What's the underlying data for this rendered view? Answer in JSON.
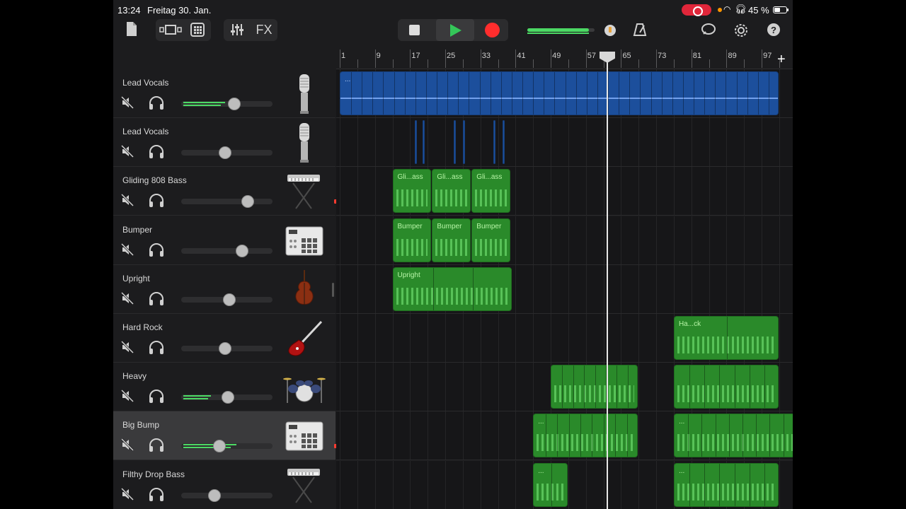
{
  "status": {
    "time": "13:24",
    "date": "Freitag 30. Jan.",
    "battery": "45 %"
  },
  "toolbar": {
    "fx_label": "FX"
  },
  "ruler": {
    "labels": [
      "1",
      "9",
      "17",
      "25",
      "33",
      "41",
      "49",
      "57",
      "65",
      "73",
      "81",
      "89",
      "97"
    ]
  },
  "tracks": [
    {
      "name": "Lead Vocals",
      "instrument": "microphone-icon",
      "volume": 0.6,
      "level": 0.55,
      "clipping": false,
      "selected": false
    },
    {
      "name": "Lead Vocals",
      "instrument": "microphone-icon",
      "volume": 0.48,
      "level": 0.0,
      "clipping": false,
      "selected": false
    },
    {
      "name": "Gliding 808 Bass",
      "instrument": "keyboard-icon",
      "volume": 0.78,
      "level": 0.0,
      "clipping": true,
      "selected": false
    },
    {
      "name": "Bumper",
      "instrument": "drum-machine-icon",
      "volume": 0.7,
      "level": 0.0,
      "clipping": false,
      "selected": false
    },
    {
      "name": "Upright",
      "instrument": "double-bass-icon",
      "volume": 0.53,
      "level": 0.0,
      "clipping": false,
      "selected": false
    },
    {
      "name": "Hard Rock",
      "instrument": "electric-guitar-icon",
      "volume": 0.48,
      "level": 0.0,
      "clipping": false,
      "selected": false
    },
    {
      "name": "Heavy",
      "instrument": "drum-kit-icon",
      "volume": 0.51,
      "level": 0.36,
      "clipping": false,
      "selected": false
    },
    {
      "name": "Big Bump",
      "instrument": "drum-machine-icon",
      "volume": 0.4,
      "level": 0.7,
      "clipping": true,
      "selected": true
    },
    {
      "name": "Filthy Drop Bass",
      "instrument": "keyboard-icon",
      "volume": 0.34,
      "level": 0.0,
      "clipping": false,
      "selected": false
    }
  ],
  "regions": [
    {
      "track": 0,
      "color": "blue",
      "start": 1,
      "end": 101,
      "label": "...",
      "segs": 40
    },
    {
      "track": 1,
      "color": "blue",
      "start": 18,
      "end": 18.6,
      "label": "",
      "segs": 0
    },
    {
      "track": 1,
      "color": "blue",
      "start": 19.8,
      "end": 20.4,
      "label": "",
      "segs": 0
    },
    {
      "track": 1,
      "color": "blue",
      "start": 27,
      "end": 27.6,
      "label": "",
      "segs": 0
    },
    {
      "track": 1,
      "color": "blue",
      "start": 29,
      "end": 29.6,
      "label": "",
      "segs": 0
    },
    {
      "track": 1,
      "color": "blue",
      "start": 36,
      "end": 36.6,
      "label": "",
      "segs": 0
    },
    {
      "track": 1,
      "color": "blue",
      "start": 38,
      "end": 38.6,
      "label": "",
      "segs": 0
    },
    {
      "track": 2,
      "color": "green",
      "start": 13,
      "end": 22,
      "label": "Gli...ass",
      "segs": 0
    },
    {
      "track": 2,
      "color": "green",
      "start": 22,
      "end": 31,
      "label": "Gli...ass",
      "segs": 0
    },
    {
      "track": 2,
      "color": "green",
      "start": 31,
      "end": 40,
      "label": "Gli...ass",
      "segs": 0
    },
    {
      "track": 3,
      "color": "green",
      "start": 13,
      "end": 22,
      "label": "Bumper",
      "segs": 0
    },
    {
      "track": 3,
      "color": "green",
      "start": 22,
      "end": 31,
      "label": "Bumper",
      "segs": 0
    },
    {
      "track": 3,
      "color": "green",
      "start": 31,
      "end": 40,
      "label": "Bumper",
      "segs": 0
    },
    {
      "track": 4,
      "color": "green",
      "start": 13,
      "end": 40.3,
      "label": "Upright",
      "segs": 2
    },
    {
      "track": 5,
      "color": "green",
      "start": 77,
      "end": 101,
      "label": "Ha...ck",
      "segs": 1
    },
    {
      "track": 6,
      "color": "green",
      "start": 49,
      "end": 69,
      "label": "",
      "segs": 7
    },
    {
      "track": 6,
      "color": "green",
      "start": 77,
      "end": 101,
      "label": "",
      "segs": 6
    },
    {
      "track": 7,
      "color": "green",
      "start": 45,
      "end": 69,
      "label": "...",
      "segs": 8
    },
    {
      "track": 7,
      "color": "green",
      "start": 77,
      "end": 105,
      "label": "...",
      "segs": 8
    },
    {
      "track": 8,
      "color": "green",
      "start": 45,
      "end": 53,
      "label": "...",
      "segs": 1
    },
    {
      "track": 8,
      "color": "green",
      "start": 77,
      "end": 101,
      "label": "...",
      "segs": 6
    }
  ]
}
